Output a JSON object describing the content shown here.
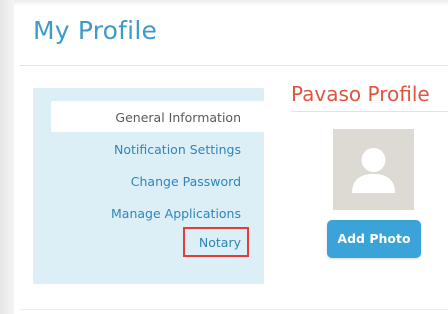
{
  "page": {
    "title": "My Profile"
  },
  "sidebar": {
    "items": [
      {
        "label": "General Information",
        "active": true
      },
      {
        "label": "Notification Settings",
        "active": false
      },
      {
        "label": "Change Password",
        "active": false
      },
      {
        "label": "Manage Applications",
        "active": false
      },
      {
        "label": "Notary",
        "active": false,
        "highlighted": true
      }
    ]
  },
  "profile": {
    "heading": "Pavaso Profile",
    "avatar_icon": "user-silhouette-icon",
    "add_photo_label": "Add Photo"
  },
  "colors": {
    "title": "#3e9bc8",
    "heading": "#e0553f",
    "link": "#2f86b7",
    "sidebar_bg": "#dceef6",
    "button_bg": "#3aa3d8",
    "highlight_border": "#e23c3c"
  }
}
